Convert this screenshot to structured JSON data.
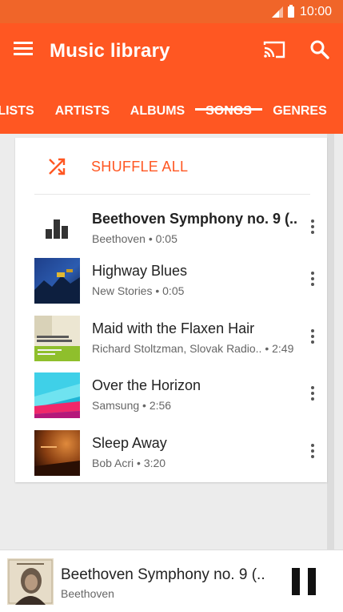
{
  "status_bar": {
    "time": "10:00"
  },
  "app_bar": {
    "title": "Music library"
  },
  "tabs": [
    "LISTS",
    "ARTISTS",
    "ALBUMS",
    "SONGS",
    "GENRES"
  ],
  "active_tab": "SONGS",
  "shuffle": {
    "label": "SHUFFLE ALL"
  },
  "songs": [
    {
      "title": "Beethoven Symphony no. 9 (..",
      "subtitle": "Beethoven • 0:05",
      "playing": true,
      "art": "bars-icon"
    },
    {
      "title": "Highway Blues",
      "subtitle": "New Stories • 0:05",
      "art": "album-art-highway-blues"
    },
    {
      "title": "Maid with the Flaxen Hair",
      "subtitle": "Richard Stoltzman, Slovak Radio..  • 2:49",
      "art": "album-art-maid-flaxen-hair"
    },
    {
      "title": "Over the Horizon",
      "subtitle": "Samsung • 2:56",
      "art": "album-art-over-the-horizon"
    },
    {
      "title": "Sleep Away",
      "subtitle": "Bob Acri • 3:20",
      "art": "album-art-sleep-away"
    }
  ],
  "now_playing": {
    "title": "Beethoven Symphony no. 9 (..",
    "artist": "Beethoven"
  },
  "colors": {
    "accent": "#ff5722",
    "status_bar": "#f06529"
  }
}
